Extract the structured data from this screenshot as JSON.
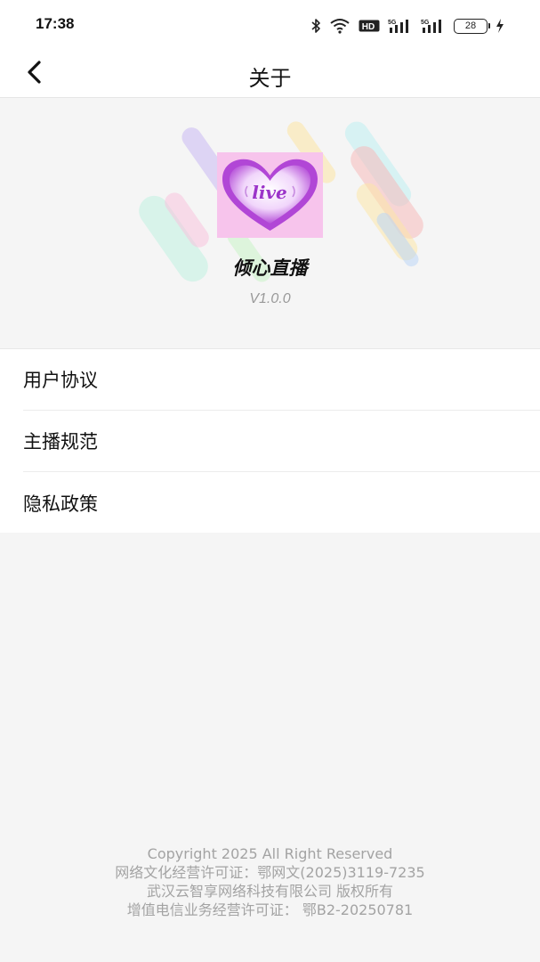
{
  "status_bar": {
    "time": "17:38",
    "icons": [
      "bluetooth-icon",
      "wifi-icon",
      "hd-icon",
      "signal-5g-icon",
      "signal-5g-icon"
    ],
    "hd_label": "HD",
    "network_label": "5G",
    "battery_level": "28"
  },
  "nav": {
    "back_icon": "chevron-left-icon",
    "title": "关于"
  },
  "about": {
    "app_name": "倾心直播",
    "version": "V1.0.0",
    "logo_text": "live",
    "colors": {
      "logo_bg": "#f7c4ec",
      "heart": "#b146d6"
    }
  },
  "menu": {
    "items": [
      {
        "label": "用户协议"
      },
      {
        "label": "主播规范"
      },
      {
        "label": "隐私政策"
      }
    ]
  },
  "footer": {
    "copyright": "Copyright 2025 All Right Reserved",
    "culture_license": "网络文化经营许可证：鄂网文(2025)3119-7235",
    "company": "武汉云智享网络科技有限公司 版权所有",
    "telecom_license": "增值电信业务经营许可证： 鄂B2-20250781"
  }
}
